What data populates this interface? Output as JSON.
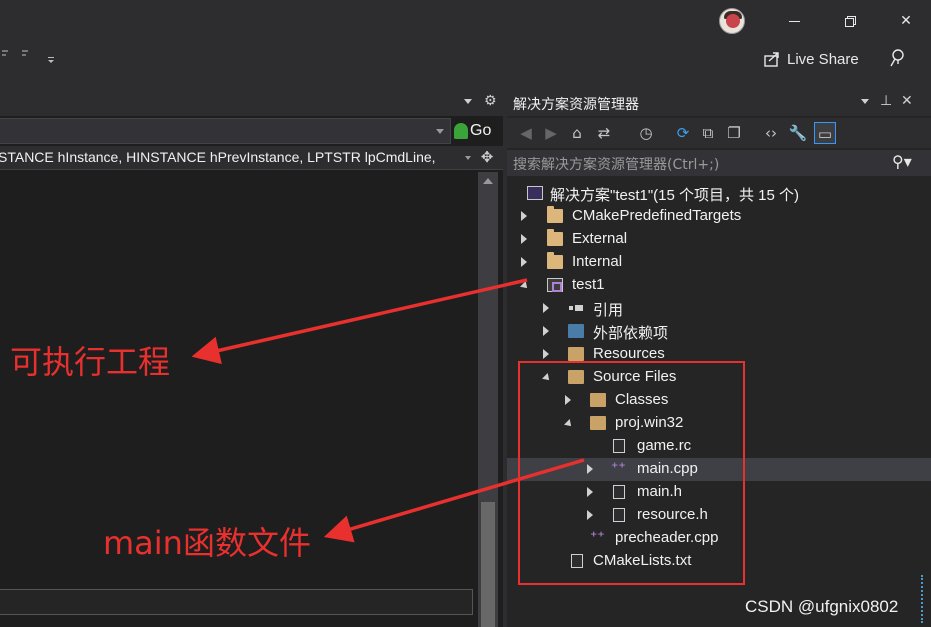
{
  "window": {
    "live_share_label": "Live Share",
    "go_label": "Go"
  },
  "editor": {
    "signature_text": "STANCE hInstance, HINSTANCE hPrevInstance, LPTSTR lpCmdLine,"
  },
  "annotations": {
    "executable_project": "可执行工程",
    "main_function_file": "main函数文件"
  },
  "solution_explorer": {
    "title": "解决方案资源管理器",
    "search_placeholder": "搜索解决方案资源管理器(Ctrl+;)",
    "tree": [
      {
        "label": "解决方案\"test1\"(15 个项目，共 15 个)",
        "icon": "solution-icon",
        "expander": "none"
      },
      {
        "label": "CMakePredefinedTargets",
        "icon": "folder-icon",
        "expander": "closed"
      },
      {
        "label": "External",
        "icon": "folder-icon",
        "expander": "closed"
      },
      {
        "label": "Internal",
        "icon": "folder-icon",
        "expander": "closed"
      },
      {
        "label": "test1",
        "icon": "project-icon",
        "expander": "open"
      },
      {
        "label": "引用",
        "icon": "references-icon",
        "expander": "closed"
      },
      {
        "label": "外部依赖项",
        "icon": "external-deps-icon",
        "expander": "closed"
      },
      {
        "label": "Resources",
        "icon": "filter-folder-icon",
        "expander": "closed"
      },
      {
        "label": "Source Files",
        "icon": "filter-folder-icon",
        "expander": "open"
      },
      {
        "label": "Classes",
        "icon": "filter-folder-icon",
        "expander": "closed"
      },
      {
        "label": "proj.win32",
        "icon": "filter-folder-icon",
        "expander": "open"
      },
      {
        "label": "game.rc",
        "icon": "rc-file-icon",
        "expander": "none"
      },
      {
        "label": "main.cpp",
        "icon": "cpp-file-icon",
        "expander": "closed",
        "selected": true
      },
      {
        "label": "main.h",
        "icon": "header-file-icon",
        "expander": "closed"
      },
      {
        "label": "resource.h",
        "icon": "header-file-icon",
        "expander": "closed"
      },
      {
        "label": "precheader.cpp",
        "icon": "cpp-file-icon",
        "expander": "none"
      },
      {
        "label": "CMakeLists.txt",
        "icon": "text-file-icon",
        "expander": "none"
      }
    ]
  },
  "watermark": "CSDN @ufgnix0802",
  "colors": {
    "annotation_red": "#e8302e",
    "selection_bg": "#3f3f46",
    "folder": "#dcb67a",
    "cpp_purple": "#b180d7"
  }
}
